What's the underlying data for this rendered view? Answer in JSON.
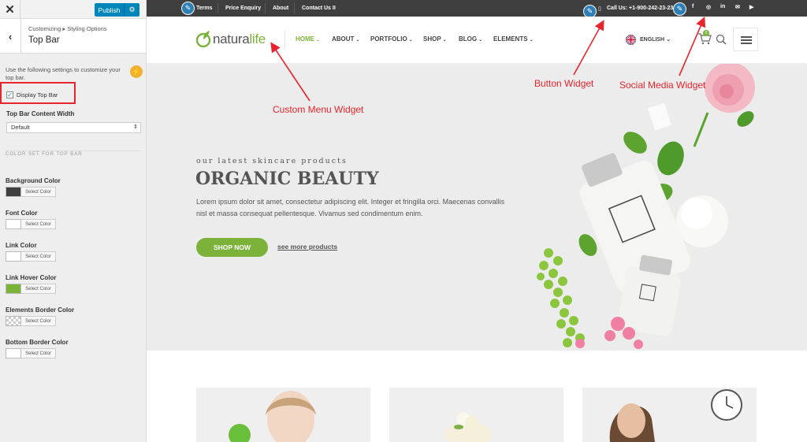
{
  "customizer": {
    "close_icon": "close-icon",
    "publish_label": "Publish",
    "breadcrumb": "Customizing ▸ Styling Options",
    "section_title": "Top Bar",
    "description": "Use the following settings to customize your top bar.",
    "display_top_bar_label": "Display Top Bar",
    "display_top_bar_checked": true,
    "content_width_label": "Top Bar Content Width",
    "content_width_value": "Default",
    "color_set_heading": "COLOR SET FOR TOP BAR",
    "select_color_label": "Select Color",
    "colors": [
      {
        "label": "Background Color",
        "value": "#3f3f3f"
      },
      {
        "label": "Font Color",
        "value": "#ffffff"
      },
      {
        "label": "Link Color",
        "value": "#ffffff"
      },
      {
        "label": "Link Hover Color",
        "value": "#7bb33a"
      },
      {
        "label": "Elements Border Color",
        "value": "transparent"
      },
      {
        "label": "Bottom Border Color",
        "value": "#ffffff"
      }
    ]
  },
  "topbar": {
    "menu": [
      "Terms",
      "Price Enquiry",
      "About",
      "Contact Us II"
    ],
    "call_label": "Call Us: +1-900-242-23-23",
    "social": [
      "f",
      "◎",
      "in",
      "✉",
      "▶"
    ]
  },
  "header": {
    "logo_part1": "natura",
    "logo_part2": "life",
    "nav": [
      "HOME",
      "ABOUT",
      "PORTFOLIO",
      "SHOP",
      "BLOG",
      "ELEMENTS"
    ],
    "language": "ENGLISH",
    "cart_count": "0"
  },
  "hero": {
    "kicker": "our latest skincare products",
    "title": "ORGANIC BEAUTY",
    "text": "Lorem ipsum dolor sit amet, consectetur adipiscing elit. Integer et fringilla orci. Maecenas convallis nisl et massa consequat pellentesque. Vivamus sed condimentum enim.",
    "shop_button": "SHOP NOW",
    "more_link": "see more products"
  },
  "annotations": {
    "custom_menu": "Custom Menu Widget",
    "button": "Button Widget",
    "social_media": "Social Media Widget"
  },
  "colors": {
    "accent_green": "#7bb33a",
    "wp_blue": "#0085ba",
    "annotation_red": "#e8242c",
    "topbar_bg": "#3f3f3f"
  }
}
